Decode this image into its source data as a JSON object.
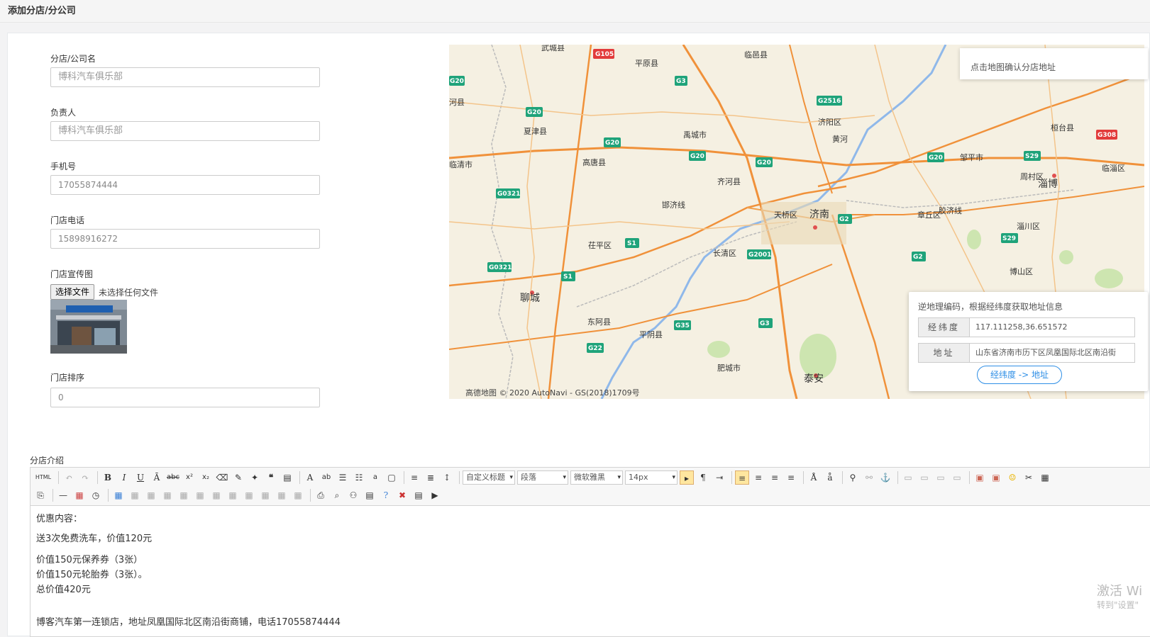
{
  "page": {
    "title": "添加分店/分公司"
  },
  "form": {
    "name_label": "分店/公司名",
    "name_value": "博科汽车俱乐部",
    "manager_label": "负责人",
    "manager_value": "博科汽车俱乐部",
    "phone_label": "手机号",
    "phone_value": "17055874444",
    "store_phone_label": "门店电话",
    "store_phone_value": "15898916272",
    "image_label": "门店宣传图",
    "file_button": "选择文件",
    "file_none": "未选择任何文件",
    "sort_label": "门店排序",
    "sort_value": "0"
  },
  "map": {
    "tip": "点击地图确认分店地址",
    "copyright": "高德地图 © 2020 AutoNavi - GS(2018)1709号",
    "places": [
      "武城县",
      "平原县",
      "临邑县",
      "河县",
      "夏津县",
      "禹城市",
      "济阳区",
      "黄河",
      "临清市",
      "高唐县",
      "齐河县",
      "邹平市",
      "周村区",
      "桓台县",
      "淄博",
      "临淄区",
      "天桥区",
      "济南",
      "章丘区",
      "淄川区",
      "茌平区",
      "长清区",
      "博山区",
      "聊城",
      "东阿县",
      "平阴县",
      "肥城市",
      "泰安",
      "胶济线",
      "邯济线"
    ],
    "roads": [
      "G105",
      "G3",
      "G20",
      "G2516",
      "G308",
      "G0321",
      "S1",
      "G2",
      "G2001",
      "S29",
      "G35",
      "G22"
    ],
    "geocode": {
      "title": "逆地理编码，根据经纬度获取地址信息",
      "latlng_label": "经纬度",
      "latlng_value": "117.111258,36.651572",
      "address_label": "地址",
      "address_value": "山东省济南市历下区凤凰国际北区南沿街",
      "button": "经纬度 -> 地址"
    }
  },
  "intro": {
    "label": "分店介绍",
    "toolbar": {
      "html": "HTML",
      "heading": "自定义标题",
      "paragraph": "段落",
      "font": "微软雅黑",
      "size": "14px"
    },
    "lines": [
      "优惠内容：",
      "送3次免费洗车，价值120元",
      "价值150元保养券（3张）",
      "价值150元轮胎券（3张）。",
      "总价值420元",
      "博客汽车第一连锁店，地址凤凰国际北区南沿街商铺，电话17055874444"
    ]
  },
  "watermark": {
    "line1": "激活 Wi",
    "line2": "转到\"设置\""
  }
}
